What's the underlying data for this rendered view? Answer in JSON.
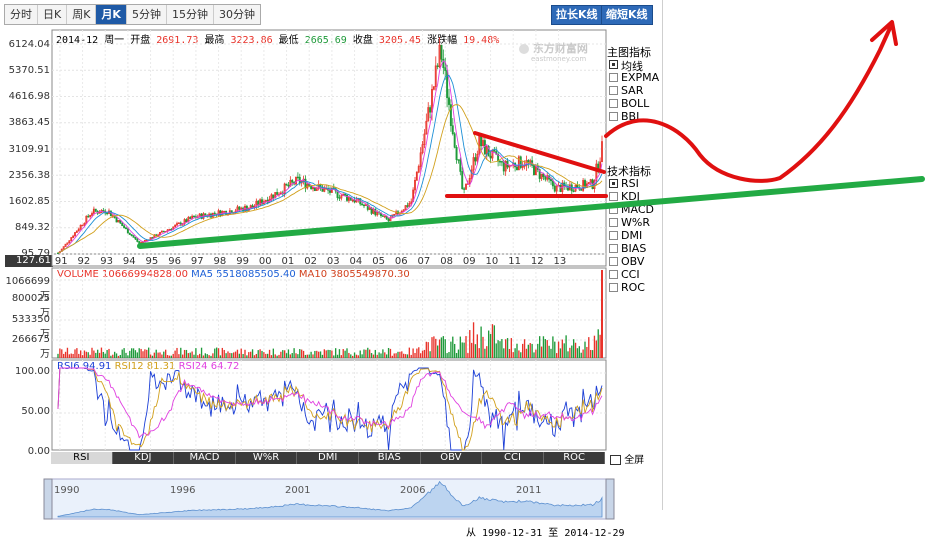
{
  "tabs": [
    "分时",
    "日K",
    "周K",
    "月K",
    "5分钟",
    "15分钟",
    "30分钟"
  ],
  "active_tab": 3,
  "buttons": {
    "extend": "拉长K线",
    "shorten": "缩短K线"
  },
  "info": {
    "date": "2014-12",
    "weekday": "周一",
    "open_label": "开盘",
    "open": "2691.73",
    "high_label": "最高",
    "high": "3223.86",
    "low_label": "最低",
    "low": "2665.69",
    "close_label": "收盘",
    "close": "3205.45",
    "chg_label": "涨跌幅",
    "chg": "19.48%"
  },
  "watermark": "东方财富网",
  "watermark_sub": "eastmoney.com",
  "main_indicators_title": "主图指标",
  "main_indicators": [
    {
      "label": "均线",
      "checked": true
    },
    {
      "label": "EXPMA",
      "checked": false
    },
    {
      "label": "SAR",
      "checked": false
    },
    {
      "label": "BOLL",
      "checked": false
    },
    {
      "label": "BBI",
      "checked": false
    }
  ],
  "tech_indicators_title": "技术指标",
  "tech_indicators": [
    {
      "label": "RSI",
      "checked": true
    },
    {
      "label": "KDJ",
      "checked": false
    },
    {
      "label": "MACD",
      "checked": false
    },
    {
      "label": "W%R",
      "checked": false
    },
    {
      "label": "DMI",
      "checked": false
    },
    {
      "label": "BIAS",
      "checked": false
    },
    {
      "label": "OBV",
      "checked": false
    },
    {
      "label": "CCI",
      "checked": false
    },
    {
      "label": "ROC",
      "checked": false
    }
  ],
  "price_axis": [
    "6124.04",
    "5370.51",
    "4616.98",
    "3863.45",
    "3109.91",
    "2356.38",
    "1602.85",
    "849.32",
    "95.79"
  ],
  "price_low_tag": "127.61",
  "year_labels": [
    "91",
    "92",
    "93",
    "94",
    "95",
    "96",
    "97",
    "98",
    "99",
    "00",
    "01",
    "02",
    "03",
    "04",
    "05",
    "06",
    "07",
    "08",
    "09",
    "10",
    "11",
    "12",
    "13"
  ],
  "volume_legend": {
    "vol": "VOLUME 10666994828.00",
    "ma5": "MA5 5518085505.40",
    "ma10": "MA10 3805549870.30"
  },
  "volume_axis": [
    "1066699万",
    "800025万",
    "533350万",
    "266675万"
  ],
  "rsi_legend": {
    "rsi6": "RSI6 94.91",
    "rsi12": "RSI12 81.31",
    "rsi24": "RSI24 64.72"
  },
  "rsi_axis": [
    "100.00",
    "50.00",
    "0.00"
  ],
  "bottom_tabs": [
    "RSI",
    "KDJ",
    "MACD",
    "W%R",
    "DMI",
    "BIAS",
    "OBV",
    "CCI",
    "ROC"
  ],
  "fullscreen": "全屏",
  "overview_years": [
    "1990",
    "1996",
    "2001",
    "2006",
    "2011"
  ],
  "range_text": {
    "from": "从",
    "start": "1990-12-31",
    "to": "至",
    "end": "2014-12-29"
  },
  "colors": {
    "up": "#e8332a",
    "down": "#1f9a3a",
    "ma5": "#e040e0",
    "ma10": "#1c8fd6",
    "ma20": "#d1a01c",
    "annot_red": "#e01010",
    "annot_green": "#22aa44"
  },
  "chart_data": {
    "type": "candlestick",
    "x": [
      "1991",
      "1992",
      "1993",
      "1994",
      "1995",
      "1996",
      "1997",
      "1998",
      "1999",
      "2000",
      "2001",
      "2002",
      "2003",
      "2004",
      "2005",
      "2006",
      "2007",
      "2008",
      "2009",
      "2010",
      "2011",
      "2012",
      "2013",
      "2014-12"
    ],
    "close": [
      292,
      780,
      833,
      648,
      555,
      917,
      1194,
      1147,
      1367,
      2073,
      1646,
      1357,
      1497,
      1267,
      1161,
      2675,
      5262,
      1821,
      3277,
      2808,
      2199,
      2269,
      2116,
      3205
    ],
    "high": [
      293,
      1429,
      1558,
      1053,
      926,
      1258,
      1510,
      1422,
      1756,
      2125,
      2245,
      1748,
      1649,
      1783,
      1328,
      2698,
      6124,
      5522,
      3478,
      3306,
      3067,
      2478,
      2444,
      3224
    ],
    "low": [
      105,
      292,
      751,
      325,
      524,
      512,
      870,
      1043,
      1047,
      1361,
      1514,
      1339,
      1307,
      1259,
      998,
      1161,
      2541,
      1664,
      1844,
      2319,
      2134,
      1949,
      1849,
      1975
    ],
    "ylim": [
      95.79,
      6124.04
    ],
    "volume_ylim": [
      0,
      1066699
    ],
    "rsi_ylim": [
      0,
      100
    ]
  }
}
